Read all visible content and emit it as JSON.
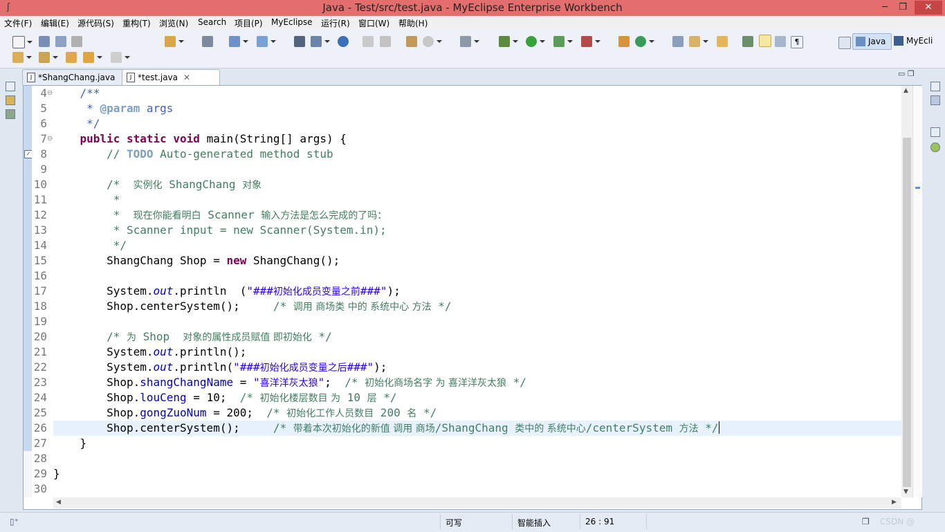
{
  "window": {
    "title": "Java - Test/src/test.java - MyEclipse Enterprise Workbench",
    "minimize": "─",
    "maximize": "❐",
    "close": "✕"
  },
  "menu": [
    "文件(F)",
    "编辑(E)",
    "源代码(S)",
    "重构(T)",
    "浏览(N)",
    "Search",
    "项目(P)",
    "MyEclipse",
    "运行(R)",
    "窗口(W)",
    "帮助(H)"
  ],
  "perspectives": {
    "java": "Java",
    "myeclipse": "MyEcli"
  },
  "tabs": [
    {
      "label": "*ShangChang.java",
      "close": ""
    },
    {
      "label": "*test.java",
      "close": "✕"
    }
  ],
  "editor": {
    "lines": [
      {
        "n": "4",
        "fold": "⊖",
        "html": "    <span class='cm'>/**</span>"
      },
      {
        "n": "5",
        "html": "     <span class='cm'>* <b style='color:#7f9fbf'>@param</b> args</span>"
      },
      {
        "n": "6",
        "html": "     <span class='cm'>*/</span>"
      },
      {
        "n": "7",
        "fold": "⊖",
        "html": "    <span class='kw'>public</span> <span class='kw'>static</span> <span class='kw'>void</span> main(String[] args) {"
      },
      {
        "n": "8",
        "html": "        <span class='cmt'>// <span class='todo'>TODO</span> Auto-generated method stub</span>"
      },
      {
        "n": "9",
        "html": ""
      },
      {
        "n": "10",
        "html": "        <span class='cmt'>/*  <span class='cjk'>实例化</span> ShangChang <span class='cjk'>对象</span></span>"
      },
      {
        "n": "11",
        "html": "         <span class='cmt'>*</span>"
      },
      {
        "n": "12",
        "html": "         <span class='cmt'>*  <span class='cjk'>现在你能看明白</span> Scanner <span class='cjk'>输入方法是怎么完成的了吗：</span></span>"
      },
      {
        "n": "13",
        "html": "         <span class='cmt'>* Scanner input = new Scanner(System.in);</span>"
      },
      {
        "n": "14",
        "html": "         <span class='cmt'>*/</span>"
      },
      {
        "n": "15",
        "html": "        ShangChang Shop = <span class='kw'>new</span> ShangChang();"
      },
      {
        "n": "16",
        "html": ""
      },
      {
        "n": "17",
        "html": "        System.<span class='ital'>out</span>.println  (<span class='str'>\"###<span class='cjk'>初始化成员变量之前</span>###\"</span>);"
      },
      {
        "n": "18",
        "html": "        Shop.centerSystem();     <span class='cmt'>/* <span class='cjk'>调用 商场类 中的 系统中心 方法</span> */</span>"
      },
      {
        "n": "19",
        "html": ""
      },
      {
        "n": "20",
        "html": "        <span class='cmt'>/* <span class='cjk'>为</span> Shop  <span class='cjk'>对象的属性成员赋值 即初始化</span> */</span>"
      },
      {
        "n": "21",
        "html": "        System.<span class='ital'>out</span>.println();"
      },
      {
        "n": "22",
        "html": "        System.<span class='ital'>out</span>.println(<span class='str'>\"###<span class='cjk'>初始化成员变量之后</span>###\"</span>);"
      },
      {
        "n": "23",
        "html": "        Shop.<span class='fld'>shangChangName</span> = <span class='str'>\"<span class='cjk'>喜洋洋灰太狼</span>\"</span>;  <span class='cmt'>/* <span class='cjk'>初始化商场名字 为 喜洋洋灰太狼</span> */</span>"
      },
      {
        "n": "24",
        "html": "        Shop.<span class='fld'>louCeng</span> = 10;  <span class='cmt'>/* <span class='cjk'>初始化楼层数目 为</span> 10 <span class='cjk'>层</span> */</span>"
      },
      {
        "n": "25",
        "html": "        Shop.<span class='fld'>gongZuoNum</span> = 200;  <span class='cmt'>/* <span class='cjk'>初始化工作人员数目</span> 200 <span class='cjk'>名</span> */</span>"
      },
      {
        "n": "26",
        "current": true,
        "html": "        Shop.centerSystem();     <span class='cmt'>/* <span class='cjk'>带着本次初始化的新值 调用 商场</span>/ShangChang <span class='cjk'>类中的 系统中心</span>/centerSystem <span class='cjk'>方法</span> */</span><span class='caret'></span>"
      },
      {
        "n": "27",
        "html": "    }"
      },
      {
        "n": "28",
        "html": ""
      },
      {
        "n": "29",
        "html": "}"
      },
      {
        "n": "30",
        "html": ""
      }
    ]
  },
  "status": {
    "writable": "可写",
    "insert_mode": "智能插入",
    "position": "26 : 91",
    "watermark": "CSDN @"
  }
}
